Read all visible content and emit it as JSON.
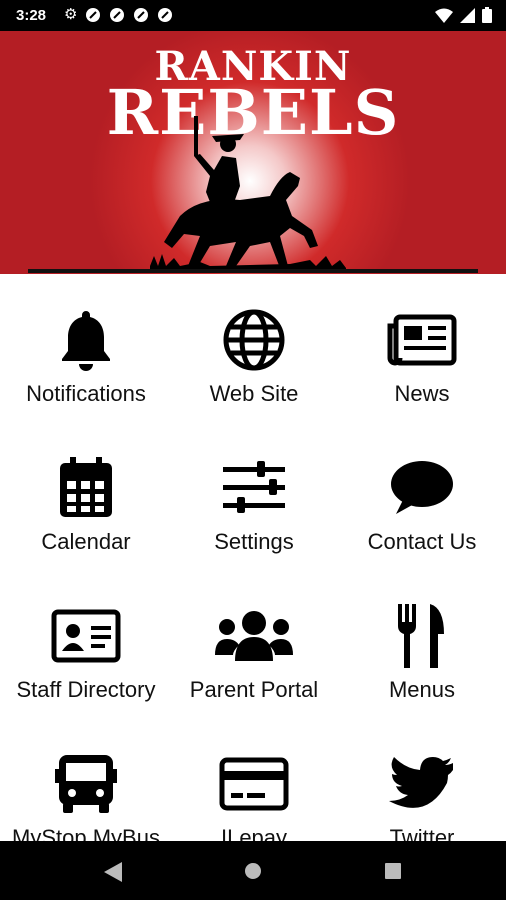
{
  "status_bar": {
    "time": "3:28"
  },
  "banner": {
    "title_line1": "RANKIN",
    "title_line2": "REBELS"
  },
  "menu": {
    "items": [
      {
        "label": "Notifications",
        "icon": "bell-icon"
      },
      {
        "label": "Web Site",
        "icon": "globe-icon"
      },
      {
        "label": "News",
        "icon": "newspaper-icon"
      },
      {
        "label": "Calendar",
        "icon": "calendar-icon"
      },
      {
        "label": "Settings",
        "icon": "sliders-icon"
      },
      {
        "label": "Contact Us",
        "icon": "chat-bubble-icon"
      },
      {
        "label": "Staff Directory",
        "icon": "id-card-icon"
      },
      {
        "label": "Parent Portal",
        "icon": "users-icon"
      },
      {
        "label": "Menus",
        "icon": "utensils-icon"
      },
      {
        "label": "MyStop MyBus",
        "icon": "bus-icon"
      },
      {
        "label": "ILepay",
        "icon": "credit-card-icon"
      },
      {
        "label": "Twitter",
        "icon": "twitter-bird-icon"
      }
    ]
  },
  "colors": {
    "banner_red": "#b41e24",
    "icon_black": "#000000"
  }
}
